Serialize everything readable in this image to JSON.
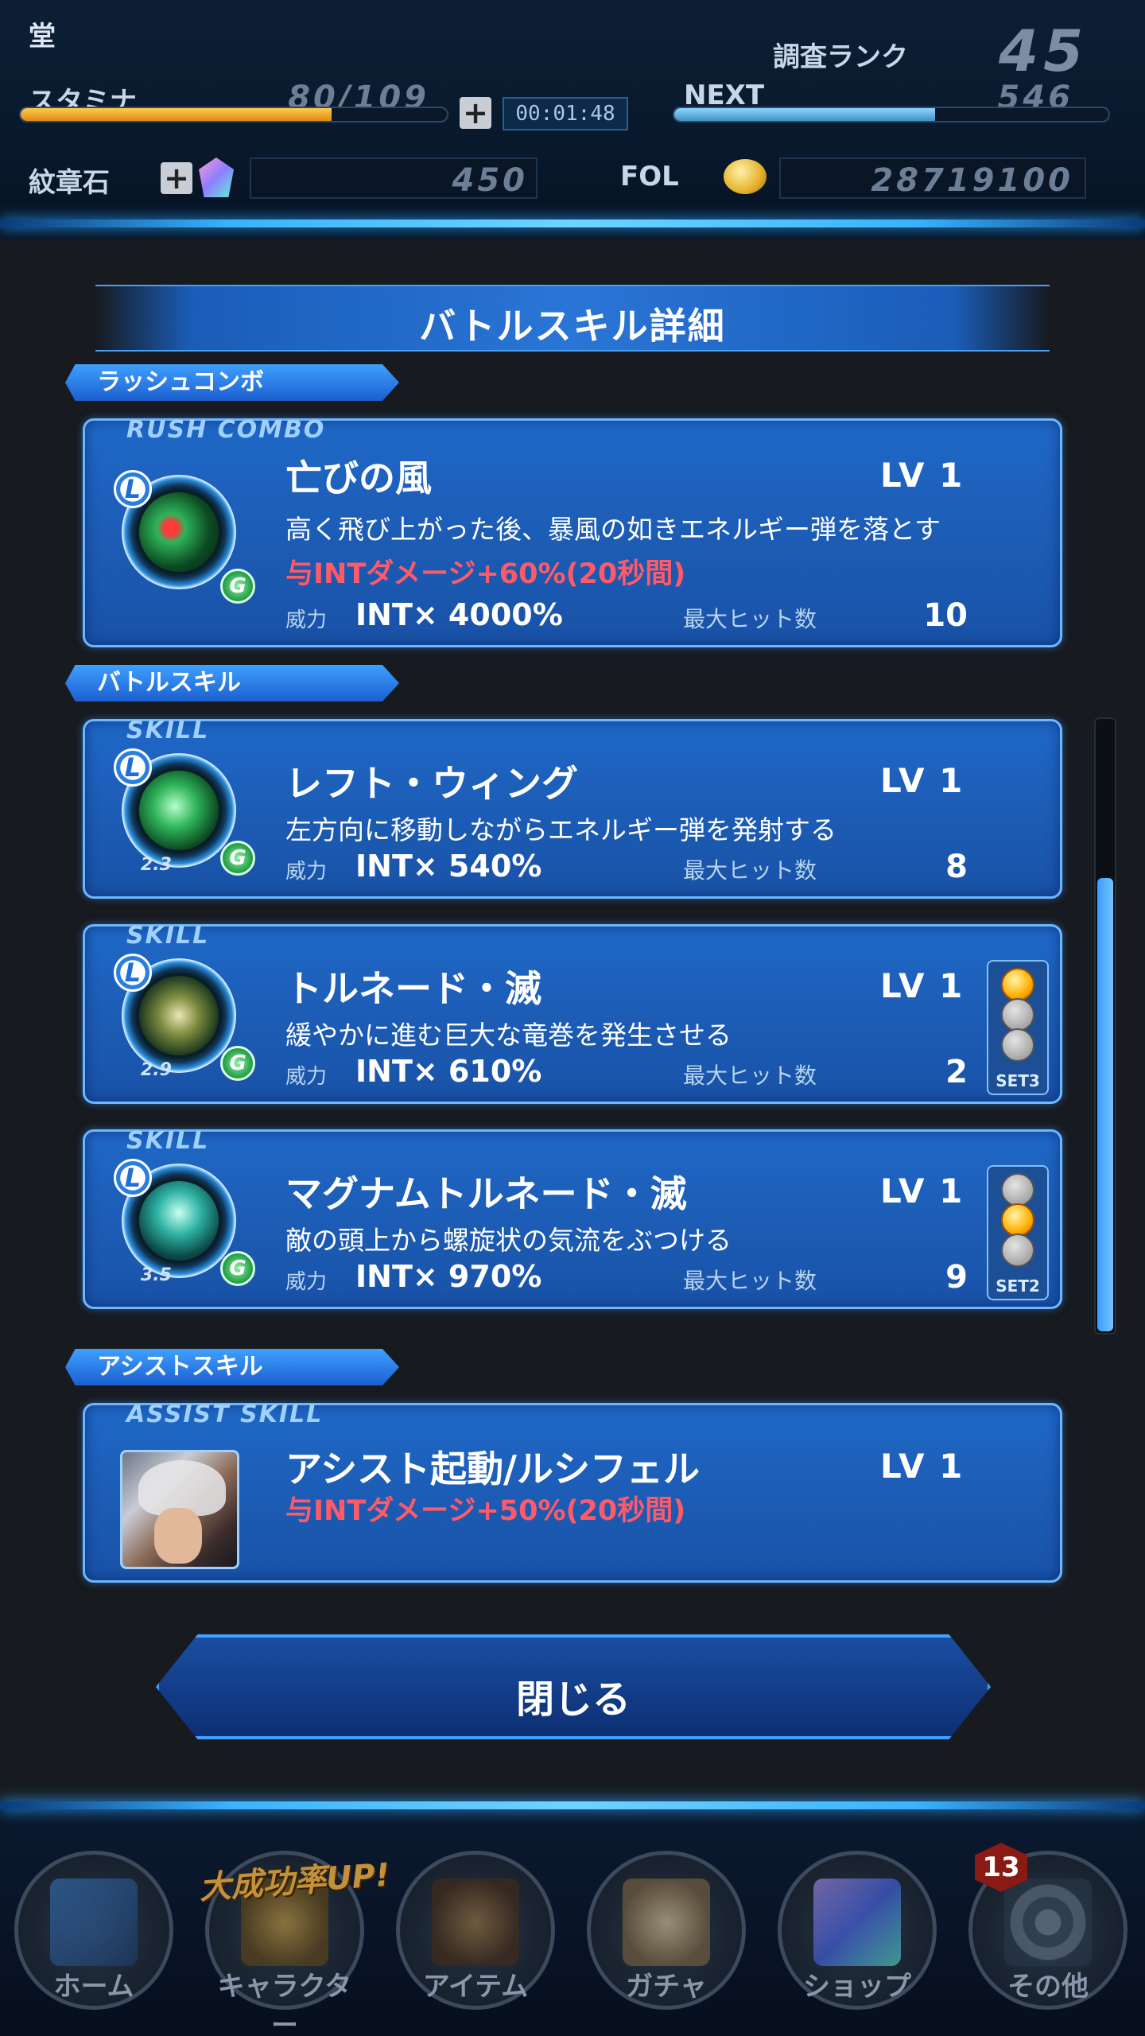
{
  "hud": {
    "place": "堂",
    "rank_label": "調査ランク",
    "rank_value": "45",
    "stamina_label": "スタミナ",
    "stamina_value": "80/109",
    "stamina_fraction": 0.73,
    "timer": "00:01:48",
    "next_label": "NEXT",
    "next_value": "546",
    "next_fraction": 0.6,
    "crest_label": "紋章石",
    "crest_value": "450",
    "fol_label": "FOL",
    "fol_value": "28719100",
    "plus_symbol": "+"
  },
  "dialog": {
    "title": "バトルスキル詳細",
    "power_label": "威力",
    "hits_label": "最大ヒット数",
    "close_label": "閉じる"
  },
  "sections": {
    "rush": "ラッシュコンボ",
    "battle": "バトルスキル",
    "assist": "アシストスキル"
  },
  "badges": {
    "leader": "L",
    "element": "G"
  },
  "rush_combo": {
    "tag": "RUSH COMBO",
    "name": "亡びの風",
    "lv": "LV 1",
    "desc": "高く飛び上がった後、暴風の如きエネルギー弾を落とす",
    "buff": "与INTダメージ+60%(20秒間)",
    "power": "INT× 4000%",
    "hits": "10"
  },
  "skills": [
    {
      "tag": "SKILL",
      "name": "レフト・ウィング",
      "lv": "LV 1",
      "desc": "左方向に移動しながらエネルギー弾を発射する",
      "power": "INT× 540%",
      "hits": "8",
      "cooldown": "2.3"
    },
    {
      "tag": "SKILL",
      "name": "トルネード・滅",
      "lv": "LV 1",
      "desc": "緩やかに進む巨大な竜巻を発生させる",
      "power": "INT× 610%",
      "hits": "2",
      "cooldown": "2.9",
      "set": "SET3"
    },
    {
      "tag": "SKILL",
      "name": "マグナムトルネード・滅",
      "lv": "LV 1",
      "desc": "敵の頭上から螺旋状の気流をぶつける",
      "power": "INT× 970%",
      "hits": "9",
      "cooldown": "3.5",
      "set": "SET2"
    }
  ],
  "assist": {
    "tag": "ASSIST SKILL",
    "name": "アシスト起動/ルシフェル",
    "lv": "LV 1",
    "buff": "与INTダメージ+50%(20秒間)"
  },
  "nav": {
    "home": "ホーム",
    "character": "キャラクター",
    "item": "アイテム",
    "gacha": "ガチャ",
    "shop": "ショップ",
    "other": "その他",
    "banner": "大成功率UP!",
    "other_count": "13"
  },
  "colors": {
    "accent": "#3fa0ff",
    "buff_red": "#ff5a68",
    "set_active": "#ffae00"
  }
}
